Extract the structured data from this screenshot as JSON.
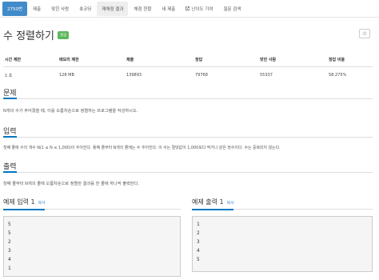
{
  "nav": {
    "tabs": [
      {
        "label": "2750번",
        "state": "active"
      },
      {
        "label": "제출",
        "state": "normal"
      },
      {
        "label": "맞힌 사람",
        "state": "normal"
      },
      {
        "label": "숏코딩",
        "state": "normal"
      },
      {
        "label": "재채점 결과",
        "state": "selected"
      },
      {
        "label": "채점 현황",
        "state": "normal"
      },
      {
        "label": "내 제출",
        "state": "normal"
      },
      {
        "label": "난이도 기여",
        "state": "normal",
        "icon": "external-link-icon"
      },
      {
        "label": "질문 검색",
        "state": "normal"
      }
    ]
  },
  "problem": {
    "title": "수 정렬하기",
    "badge": "성공",
    "star_icon": "star-icon"
  },
  "info_table": {
    "headers": [
      "시간 제한",
      "메모리 제한",
      "제출",
      "정답",
      "맞힌 사람",
      "정답 비율"
    ],
    "row": [
      "1 초",
      "128 MB",
      "139893",
      "79768",
      "55337",
      "58.275%"
    ]
  },
  "sections": {
    "problem": {
      "heading": "문제",
      "text": "N개의 수가 주어졌을 때, 이를 오름차순으로 정렬하는 프로그램을 작성하시오."
    },
    "input": {
      "heading": "입력",
      "text": "첫째 줄에 수의 개수 N(1 ≤ N ≤ 1,000)이 주어진다. 둘째 줄부터 N개의 줄에는 수 주어진다. 이 수는 절댓값이 1,000보다 작거나 같은 정수이다. 수는 중복되지 않는다."
    },
    "output": {
      "heading": "출력",
      "text": "첫째 줄부터 N개의 줄에 오름차순으로 정렬한 결과를 한 줄에 하나씩 출력한다."
    }
  },
  "samples": {
    "input": {
      "heading": "예제 입력 1",
      "copy": "복사",
      "lines": [
        "5",
        "5",
        "2",
        "3",
        "4",
        "1"
      ]
    },
    "output": {
      "heading": "예제 출력 1",
      "copy": "복사",
      "lines": [
        "1",
        "2",
        "3",
        "4",
        "5"
      ]
    }
  },
  "colors": {
    "active_tab": "#428bca",
    "success_badge": "#5cb85c",
    "accent_underline": "#0076c0"
  }
}
